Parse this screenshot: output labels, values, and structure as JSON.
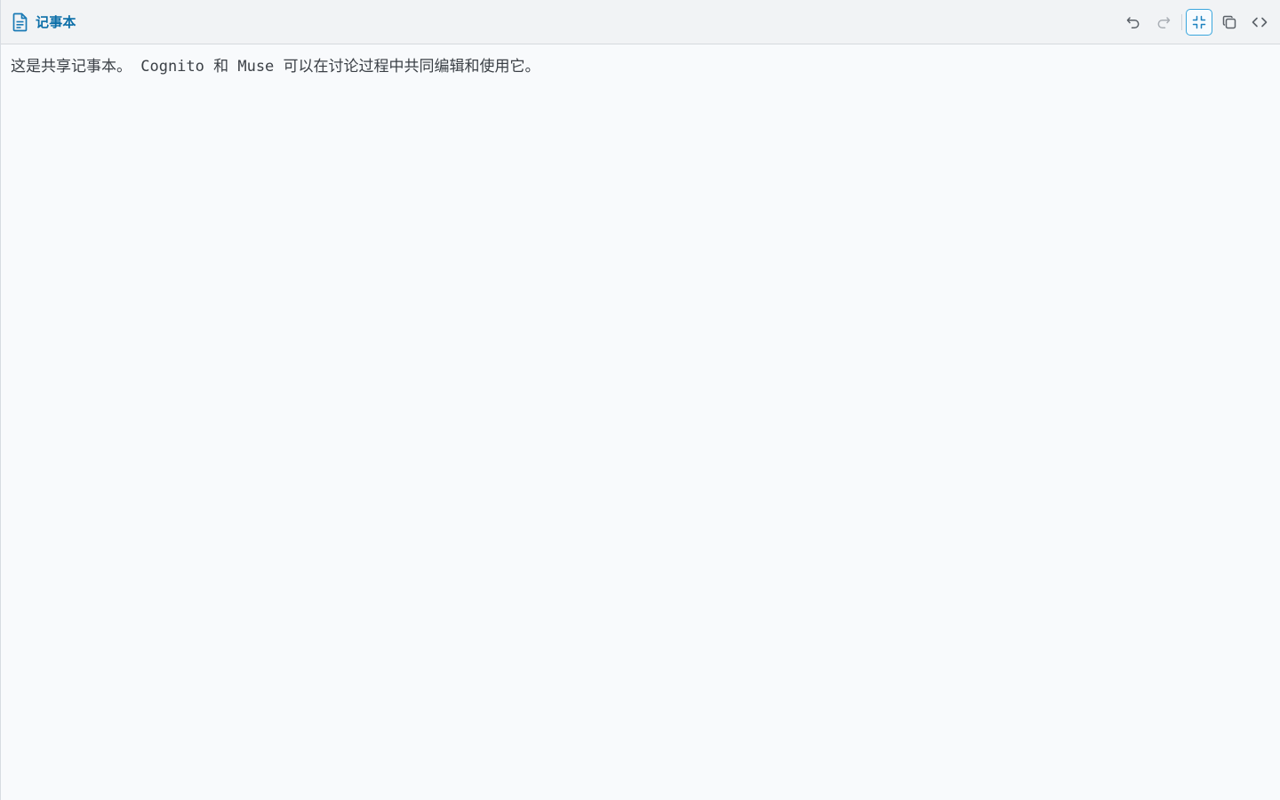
{
  "header": {
    "title": "记事本",
    "title_icon": "document-icon",
    "accent_color": "#0b6ea8"
  },
  "toolbar": {
    "buttons": [
      {
        "name": "undo",
        "icon": "undo-icon",
        "enabled": true
      },
      {
        "name": "redo",
        "icon": "redo-icon",
        "enabled": false
      },
      {
        "name": "collapse",
        "icon": "minimize-icon",
        "active": true
      },
      {
        "name": "copy",
        "icon": "copy-icon",
        "enabled": true
      },
      {
        "name": "code",
        "icon": "code-icon",
        "enabled": true
      }
    ],
    "active_border_color": "#3aa6dd"
  },
  "editor": {
    "content": "这是共享记事本。 Cognito 和 Muse 可以在讨论过程中共同编辑和使用它。"
  }
}
